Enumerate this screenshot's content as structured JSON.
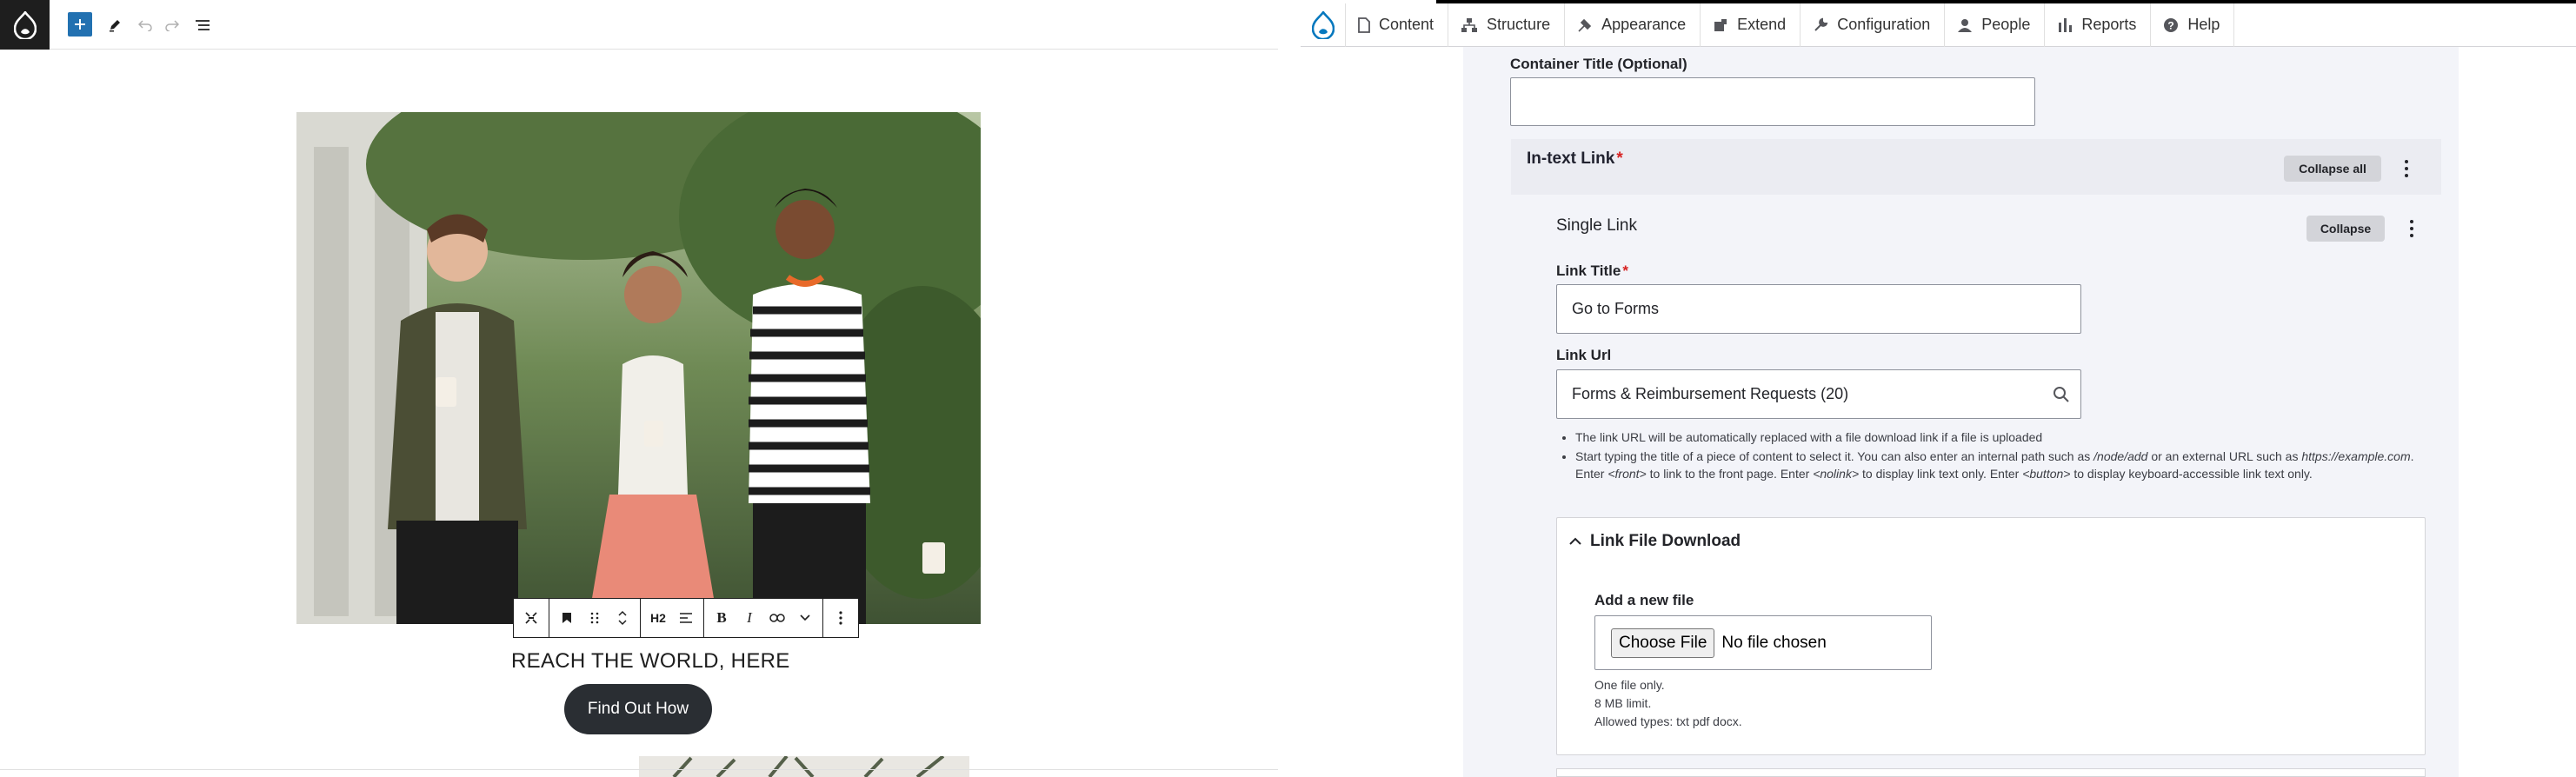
{
  "editor": {
    "toolbar": {
      "add_icon": "plus-icon",
      "edit_icon": "pencil-icon",
      "undo_icon": "undo-icon",
      "redo_icon": "redo-icon",
      "outline_icon": "list-view-icon"
    },
    "block_toolbar": {
      "heading_level": "H2",
      "bold": "B",
      "italic": "I"
    },
    "heading": "REACH THE WORLD, HERE",
    "cta_label": "Find Out How"
  },
  "admin": {
    "menu": [
      {
        "label": "Content",
        "icon": "content-icon"
      },
      {
        "label": "Structure",
        "icon": "structure-icon"
      },
      {
        "label": "Appearance",
        "icon": "appearance-icon"
      },
      {
        "label": "Extend",
        "icon": "extend-icon"
      },
      {
        "label": "Configuration",
        "icon": "configuration-icon"
      },
      {
        "label": "People",
        "icon": "people-icon"
      },
      {
        "label": "Reports",
        "icon": "reports-icon"
      },
      {
        "label": "Help",
        "icon": "help-icon"
      }
    ],
    "form": {
      "container_title_label": "Container Title (Optional)",
      "container_title_value": "",
      "intext_link_label": "In-text Link",
      "collapse_all_label": "Collapse all",
      "single_link_label": "Single Link",
      "collapse_label": "Collapse",
      "link_title_label": "Link Title",
      "link_title_value": "Go to Forms",
      "link_url_label": "Link Url",
      "link_url_value": "Forms & Reimbursement Requests (20)",
      "help_1": "The link URL will be automatically replaced with a file download link if a file is uploaded",
      "help_2_a": "Start typing the title of a piece of content to select it. You can also enter an internal path such as ",
      "help_2_path": "/node/add",
      "help_2_b": " or an external URL such as ",
      "help_2_url": "https://example.com",
      "help_2_c": ". Enter ",
      "help_2_front": "<front>",
      "help_2_d": " to link to the front page. Enter ",
      "help_2_nolink": "<nolink>",
      "help_2_e": " to display link text only. Enter ",
      "help_2_button": "<button>",
      "help_2_f": " to display keyboard-accessible link text only.",
      "file_section_title": "Link File Download",
      "add_file_label": "Add a new file",
      "choose_file_label": "Choose File",
      "no_file_text": "No file chosen",
      "file_limit_1": "One file only.",
      "file_limit_2": "8 MB limit.",
      "file_limit_3": "Allowed types: txt pdf docx."
    }
  },
  "colors": {
    "drupal_blue": "#0678be",
    "wp_blue": "#2271b1",
    "form_bg": "#f3f4f9",
    "required": "#d72222",
    "cta_bg": "#2a2e33"
  }
}
